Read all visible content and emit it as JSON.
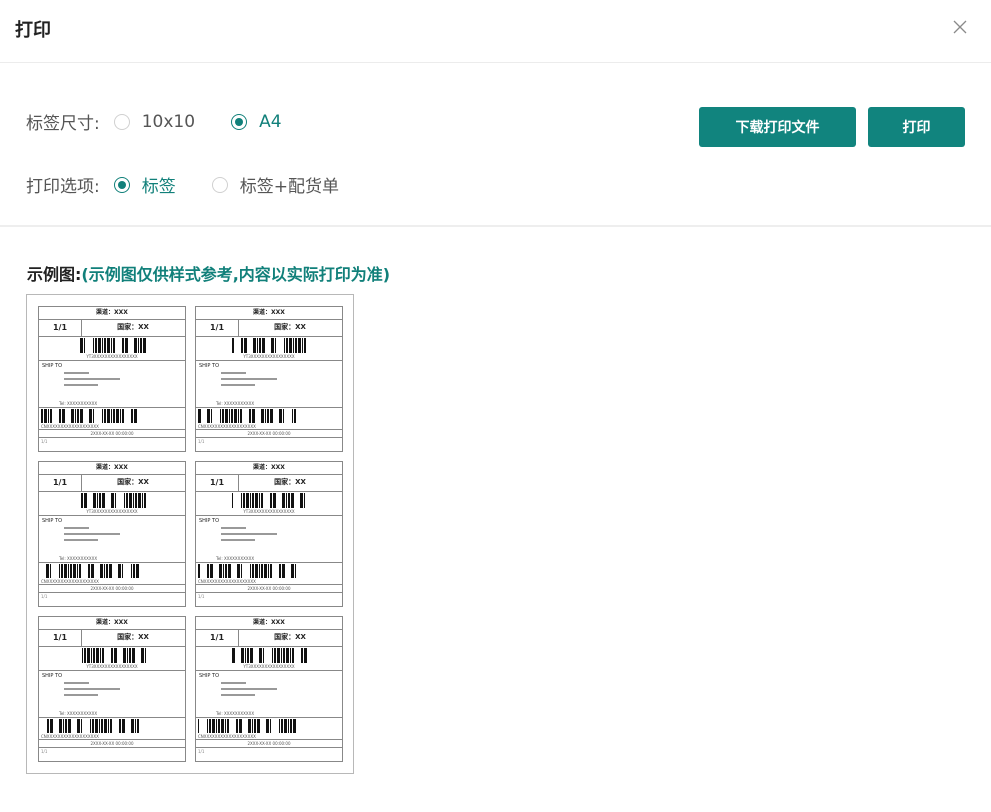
{
  "dialog": {
    "title": "打印",
    "close_icon": "close-icon"
  },
  "options": {
    "size": {
      "label": "标签尺寸:",
      "choices": [
        "10x10",
        "A4"
      ],
      "selected": "A4"
    },
    "print": {
      "label": "打印选项:",
      "choices": [
        "标签",
        "标签+配货单"
      ],
      "selected": "标签"
    }
  },
  "buttons": {
    "download": "下载打印文件",
    "print": "打印"
  },
  "example": {
    "label": "示例图:",
    "note": "(示例图仅供样式参考,内容以实际打印为准)",
    "labels_count": 6
  },
  "sample_label": {
    "channel": "渠道：XXX",
    "fraction": "1/1",
    "country": "国家：XX",
    "ship_to": "SHIP TO",
    "tel": "Tel: XXXXXXXXXXX",
    "cn": "CNXXXXXXXXXXXXXXXXXXX",
    "time": "2XXX-XX-XX 00:00:00",
    "footer": "1/1"
  },
  "colors": {
    "accent": "#11847e",
    "accent_text": "#11807a"
  }
}
